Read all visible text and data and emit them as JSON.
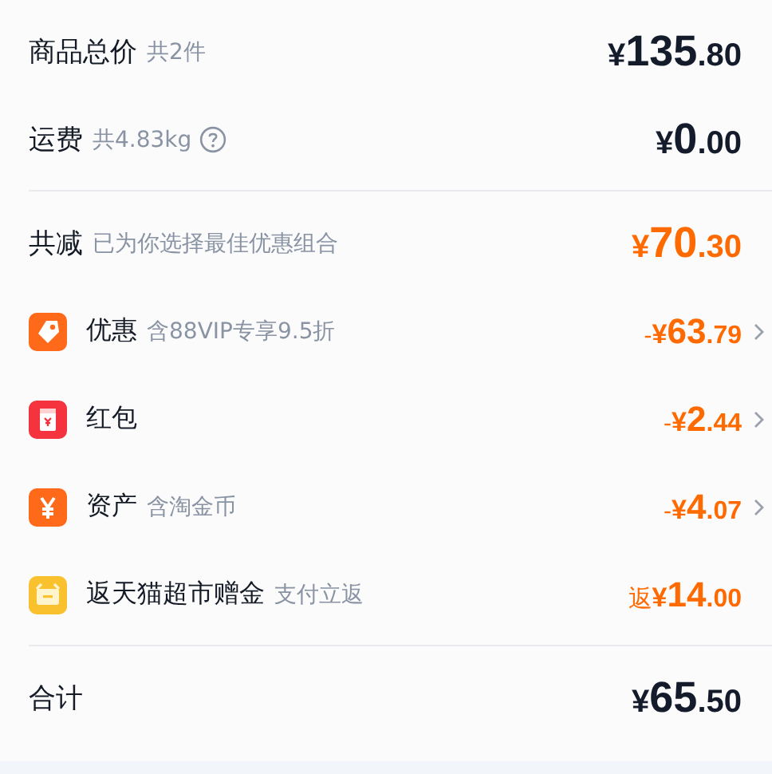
{
  "sections": [
    {
      "rows": [
        {
          "kind": "summary",
          "label": "商品总价",
          "note": "共2件",
          "help": false,
          "amount": {
            "currency": "¥",
            "integer": "135",
            "decimal": ".80"
          },
          "expandable": false
        },
        {
          "kind": "summary",
          "label": "运费",
          "note": "共4.83kg",
          "help": true,
          "amount": {
            "currency": "¥",
            "integer": "0",
            "decimal": ".00"
          },
          "expandable": false
        }
      ]
    },
    {
      "rows": [
        {
          "kind": "summary",
          "label": "共减",
          "note": "已为你选择最佳优惠组合",
          "help": false,
          "amount": {
            "currency": "¥",
            "integer": "70",
            "decimal": ".30"
          },
          "expandable": false
        },
        {
          "kind": "coupon",
          "label": "优惠",
          "note": "含88VIP专享9.5折",
          "help": false,
          "amount": {
            "prefix": "-",
            "currency": "¥",
            "integer": "63",
            "decimal": ".79"
          },
          "expandable": true
        },
        {
          "kind": "packet",
          "label": "红包",
          "help": false,
          "amount": {
            "prefix": "-",
            "currency": "¥",
            "integer": "2",
            "decimal": ".44"
          },
          "expandable": true
        },
        {
          "kind": "assets",
          "label": "资产",
          "note": "含淘金币",
          "help": false,
          "amount": {
            "prefix": "-",
            "currency": "¥",
            "integer": "4",
            "decimal": ".07"
          },
          "expandable": true
        },
        {
          "kind": "rebate",
          "label": "返天猫超市赠金",
          "note": "支付立返",
          "help": false,
          "amount": {
            "prefix": "返",
            "currency": "¥",
            "integer": "14",
            "decimal": ".00"
          },
          "expandable": false
        }
      ]
    },
    {
      "rows": [
        {
          "kind": "summary",
          "label": "合计",
          "help": false,
          "amount": {
            "currency": "¥",
            "integer": "65",
            "decimal": ".50"
          },
          "expandable": false
        }
      ]
    }
  ]
}
